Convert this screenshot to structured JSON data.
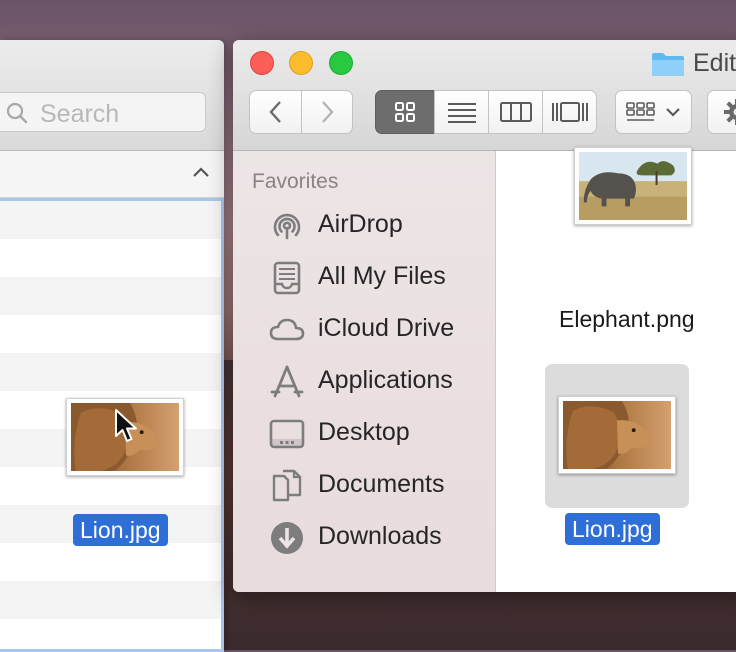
{
  "back_window": {
    "search": {
      "placeholder": "Search",
      "icon": "magnifier-icon"
    },
    "header": {
      "sort_icon": "chevron-up-icon"
    },
    "dragged_file": {
      "name": "Lion.jpg"
    }
  },
  "front_window": {
    "title": "Edit",
    "toolbar": {
      "back_icon": "chevron-left-icon",
      "forward_icon": "chevron-right-icon",
      "view_modes": [
        "icon-view",
        "list-view",
        "column-view",
        "cover-flow-view"
      ],
      "selected_view": "icon-view",
      "arrange_icon": "grid-arrange-icon",
      "action_icon": "gear-icon"
    },
    "sidebar": {
      "section_title": "Favorites",
      "items": [
        {
          "label": "AirDrop",
          "icon": "airdrop-icon"
        },
        {
          "label": "All My Files",
          "icon": "all-my-files-icon"
        },
        {
          "label": "iCloud Drive",
          "icon": "cloud-icon"
        },
        {
          "label": "Applications",
          "icon": "applications-icon"
        },
        {
          "label": "Desktop",
          "icon": "desktop-icon"
        },
        {
          "label": "Documents",
          "icon": "documents-icon"
        },
        {
          "label": "Downloads",
          "icon": "downloads-icon"
        }
      ]
    },
    "files": [
      {
        "name": "Elephant.png",
        "selected": false
      },
      {
        "name": "Lion.jpg",
        "selected": true
      }
    ]
  },
  "colors": {
    "selection_blue": "#2d6fd6",
    "close": "#fc5f57",
    "minimize": "#fdbc2e",
    "zoom": "#28c840"
  }
}
